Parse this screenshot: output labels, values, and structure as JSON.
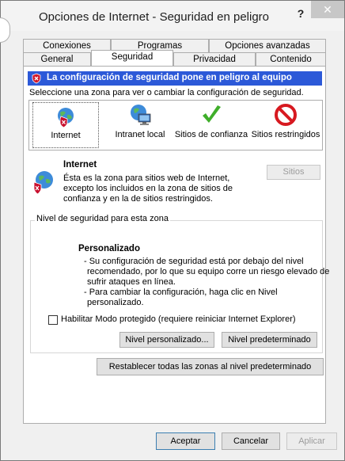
{
  "window": {
    "title": "Opciones de Internet - Seguridad en peligro",
    "help": "?",
    "close": "✕"
  },
  "tabs": {
    "row1": [
      "Conexiones",
      "Programas",
      "Opciones avanzadas"
    ],
    "row2": [
      "General",
      "Seguridad",
      "Privacidad",
      "Contenido"
    ],
    "active": "Seguridad"
  },
  "warning": "La configuración de seguridad pone en peligro al equipo",
  "zone_prompt": "Seleccione una zona para ver o cambiar la configuración de seguridad.",
  "zones": [
    {
      "label": "Internet",
      "icon": "globe-shield-icon"
    },
    {
      "label": "Intranet local",
      "icon": "network-computer-icon"
    },
    {
      "label": "Sitios de confianza",
      "icon": "checkmark-icon"
    },
    {
      "label": "Sitios restringidos",
      "icon": "no-entry-icon"
    }
  ],
  "selected_zone": {
    "name": "Internet",
    "description": [
      "Ésta es la zona para sitios web de Internet,",
      "excepto los incluidos en la zona de sitios de",
      "confianza y en la de sitios restringidos."
    ],
    "sites_button": "Sitios"
  },
  "security_level": {
    "group_label": "Nivel de seguridad para esta zona",
    "title": "Personalizado",
    "lines": [
      "- Su configuración de seguridad está por debajo del nivel",
      "recomendado, por lo que su equipo corre un riesgo elevado de",
      "sufrir ataques en línea.",
      "- Para cambiar la configuración, haga clic en Nivel",
      "personalizado."
    ],
    "protected_mode_label": "Habilitar Modo protegido (requiere reiniciar Internet Explorer)",
    "protected_mode_checked": false,
    "custom_level_button": "Nivel personalizado...",
    "default_level_button": "Nivel predeterminado"
  },
  "reset_all_button": "Restablecer todas las zonas al nivel predeterminado",
  "footer": {
    "ok": "Aceptar",
    "cancel": "Cancelar",
    "apply": "Aplicar"
  },
  "colors": {
    "warning_bar": "#2c59d8",
    "close_button": "#c7c7c7"
  }
}
